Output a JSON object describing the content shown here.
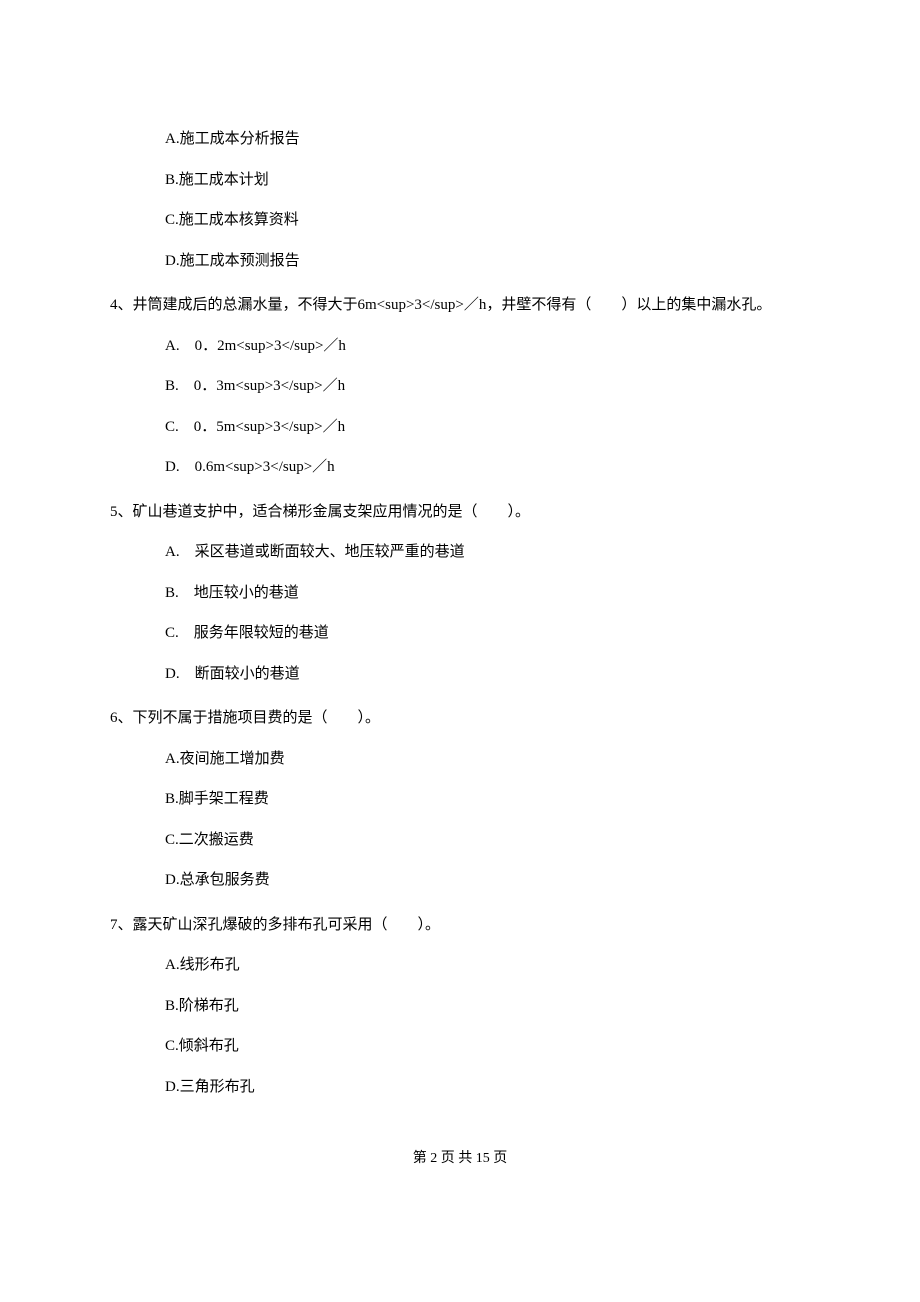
{
  "opts3": {
    "A": "A.施工成本分析报告",
    "B": "B.施工成本计划",
    "C": "C.施工成本核算资料",
    "D": "D.施工成本预测报告"
  },
  "q4": "4、井筒建成后的总漏水量，不得大于6m<sup>3</sup>／h，井壁不得有（　　）以上的集中漏水孔。",
  "opts4": {
    "A": "A.　0．2m<sup>3</sup>／h",
    "B": "B.　0．3m<sup>3</sup>／h",
    "C": "C.　0．5m<sup>3</sup>／h",
    "D": "D.　0.6m<sup>3</sup>／h"
  },
  "q5": "5、矿山巷道支护中，适合梯形金属支架应用情况的是（　　）。",
  "opts5": {
    "A": "A.　采区巷道或断面较大、地压较严重的巷道",
    "B": "B.　地压较小的巷道",
    "C": "C.　服务年限较短的巷道",
    "D": "D.　断面较小的巷道"
  },
  "q6": "6、下列不属于措施项目费的是（　　）。",
  "opts6": {
    "A": "A.夜间施工增加费",
    "B": "B.脚手架工程费",
    "C": "C.二次搬运费",
    "D": "D.总承包服务费"
  },
  "q7": "7、露天矿山深孔爆破的多排布孔可采用（　　）。",
  "opts7": {
    "A": "A.线形布孔",
    "B": "B.阶梯布孔",
    "C": "C.倾斜布孔",
    "D": "D.三角形布孔"
  },
  "footer": "第 2 页 共 15 页"
}
